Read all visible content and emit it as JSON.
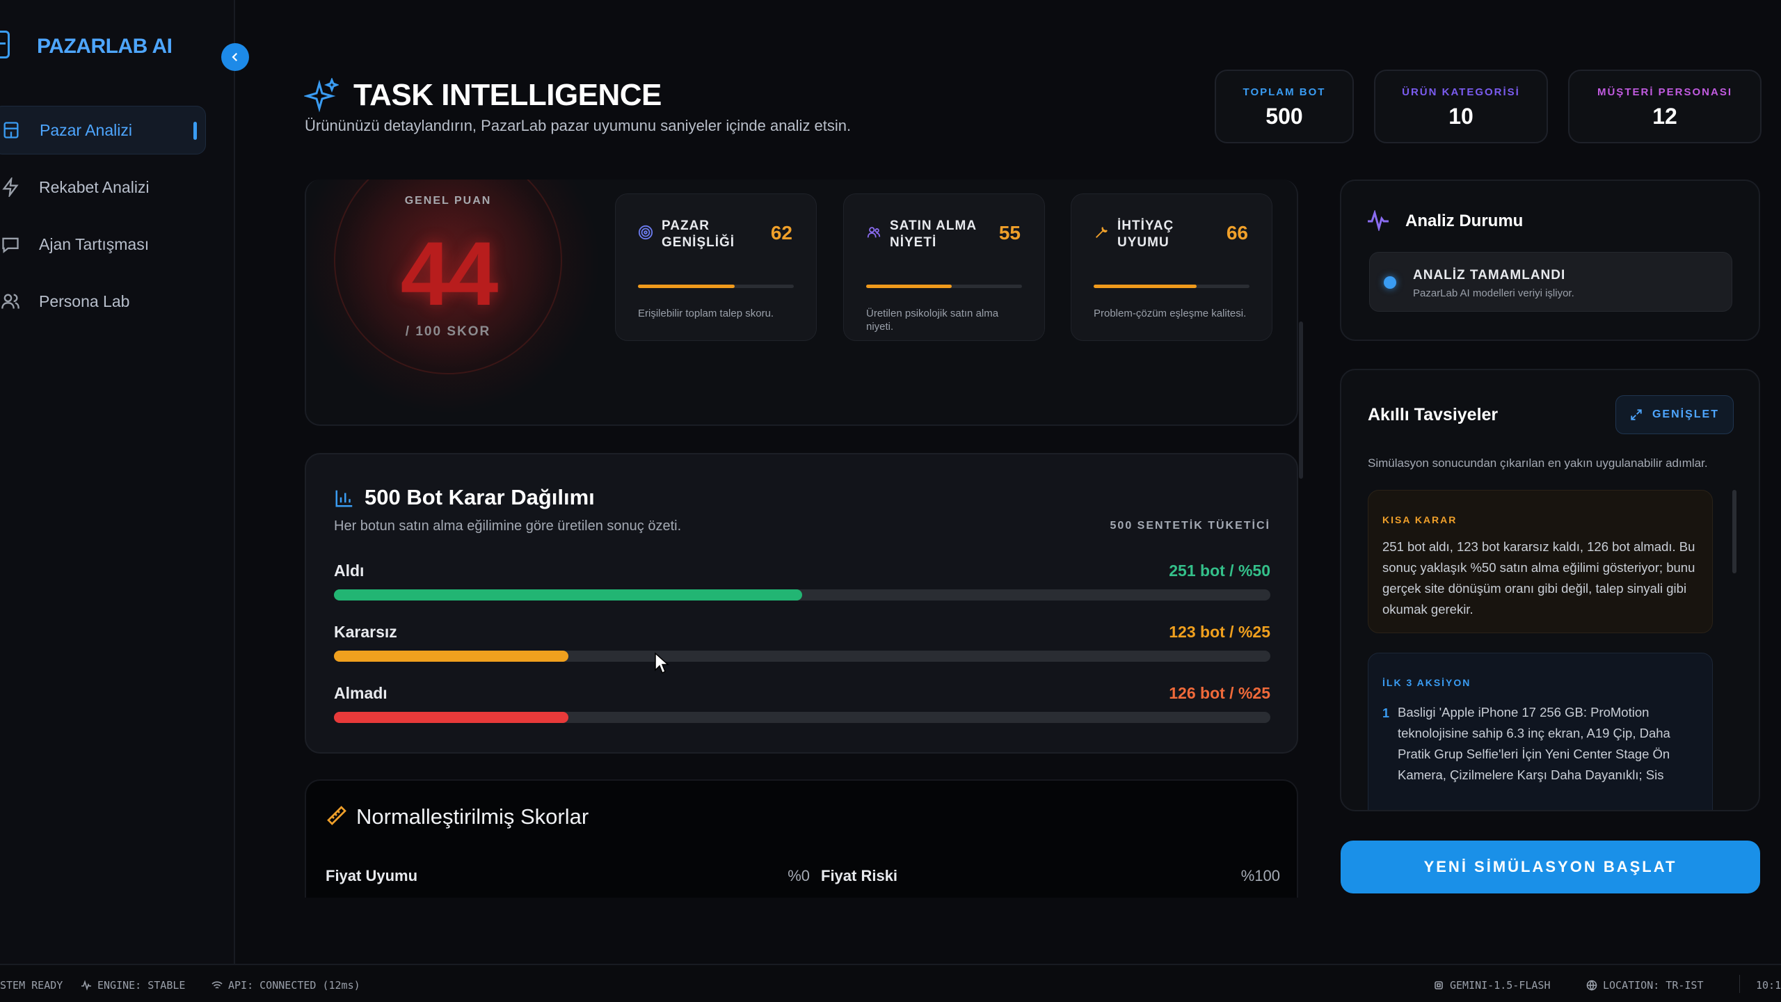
{
  "app": {
    "logo_text": "PAZARLAB AI",
    "title": "TASK INTELLIGENCE",
    "subtitle": "Ürününüzü detaylandırın, PazarLab pazar uyumunu saniyeler içinde analiz etsin."
  },
  "sidebar": {
    "items": [
      {
        "label": "Pazar Analizi",
        "icon": "store-icon",
        "active": true
      },
      {
        "label": "Rekabet Analizi",
        "icon": "bolt-icon",
        "active": false
      },
      {
        "label": "Ajan Tartışması",
        "icon": "chat-icon",
        "active": false
      },
      {
        "label": "Persona Lab",
        "icon": "users-icon",
        "active": false
      }
    ]
  },
  "stats": [
    {
      "label": "TOPLAM BOT",
      "value": "500",
      "color": "#3a9cf2"
    },
    {
      "label": "ÜRÜN KATEGORİSİ",
      "value": "10",
      "color": "#7b5cf0"
    },
    {
      "label": "MÜŞTERİ PERSONASI",
      "value": "12",
      "color": "#c15be0"
    }
  ],
  "score": {
    "label": "GENEL PUAN",
    "value": "44",
    "unit": "/ 100 SKOR"
  },
  "metrics": [
    {
      "name": "PAZAR GENİŞLİĞİ",
      "value": "62",
      "level": 0.62,
      "desc": "Erişilebilir toplam talep skoru.",
      "icon": "target-icon"
    },
    {
      "name": "SATIN ALMA NİYETİ",
      "value": "55",
      "level": 0.55,
      "desc": "Üretilen psikolojik satın alma niyeti.",
      "icon": "persons-icon"
    },
    {
      "name": "İHTİYAÇ UYUMU",
      "value": "66",
      "level": 0.66,
      "desc": "Problem-çözüm eşleşme kalitesi.",
      "icon": "wrench-icon"
    }
  ],
  "distribution": {
    "title": "500 Bot Karar Dağılımı",
    "subtitle": "Her botun satın alma eğilimine göre üretilen sonuç özeti.",
    "total_label": "500 SENTETİK TÜKETİCİ",
    "rows": [
      {
        "label": "Aldı",
        "value": "251 bot / %50",
        "fraction": 0.5,
        "color": "#22b573",
        "value_color": "#34c08a"
      },
      {
        "label": "Kararsız",
        "value": "123 bot / %25",
        "fraction": 0.25,
        "color": "#f0a01e",
        "value_color": "#f0a01e"
      },
      {
        "label": "Almadı",
        "value": "126 bot / %25",
        "fraction": 0.25,
        "color": "#e83a3a",
        "value_color": "#f06a3a"
      }
    ]
  },
  "normalized": {
    "title": "Normalleştirilmiş Skorlar",
    "items": [
      {
        "label": "Fiyat Uyumu",
        "value": "%0"
      },
      {
        "label": "Fiyat Riski",
        "value": "%100"
      }
    ]
  },
  "analysis_status": {
    "title": "Analiz Durumu",
    "status": "ANALİZ TAMAMLANDI",
    "detail": "PazarLab AI modelleri veriyi işliyor."
  },
  "recommendations": {
    "title": "Akıllı Tavsiyeler",
    "expand_label": "GENİŞLET",
    "subtitle": "Simülasyon sonucundan çıkarılan en yakın uygulanabilir adımlar.",
    "decision_label": "KISA KARAR",
    "decision_text": "251 bot aldı, 123 bot kararsız kaldı, 126 bot almadı. Bu sonuç yaklaşık %50 satın alma eğilimi gösteriyor; bunu gerçek site dönüşüm oranı gibi değil, talep sinyali gibi okumak gerekir.",
    "actions_label": "İLK 3 AKSİYON",
    "action_1_num": "1",
    "action_1_text": "Basligi 'Apple iPhone 17 256 GB: ProMotion teknolojisine sahip 6.3 inç ekran, A19 Çip, Daha Pratik Grup Selfie'leri İçin Yeni Center Stage Ön Kamera, Çizilmelere Karşı Daha Dayanıklı; Sis"
  },
  "new_simulation_label": "YENİ SİMÜLASYON BAŞLAT",
  "statusbar": {
    "system": "STEM READY",
    "engine": "ENGINE: STABLE",
    "api": "API: CONNECTED (12ms)",
    "model": "GEMINI-1.5-FLASH",
    "location": "LOCATION: TR-IST",
    "time": "10:1"
  }
}
